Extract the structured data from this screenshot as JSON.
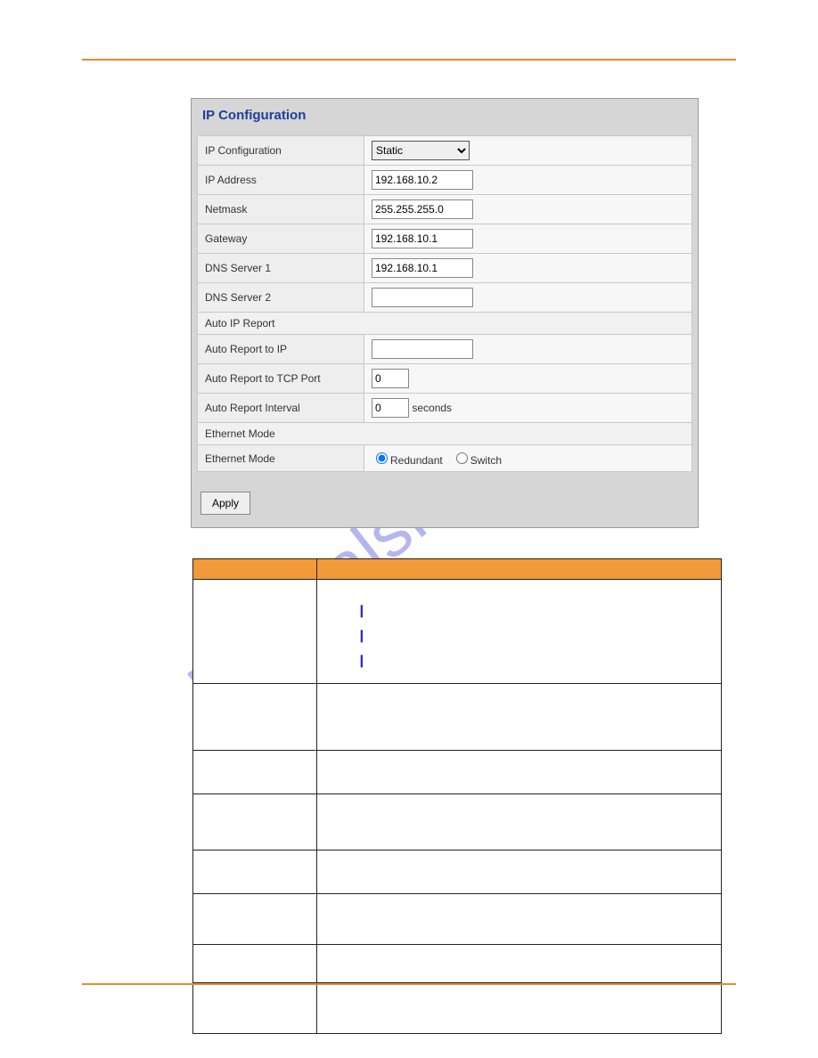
{
  "watermark": "manualshive.com",
  "panel": {
    "title": "IP Configuration",
    "rows": {
      "ip_configuration_label": "IP Configuration",
      "ip_configuration_value": "Static",
      "ip_address_label": "IP Address",
      "ip_address_value": "192.168.10.2",
      "netmask_label": "Netmask",
      "netmask_value": "255.255.255.0",
      "gateway_label": "Gateway",
      "gateway_value": "192.168.10.1",
      "dns1_label": "DNS Server 1",
      "dns1_value": "192.168.10.1",
      "dns2_label": "DNS Server 2",
      "dns2_value": "",
      "section_auto": "Auto IP Report",
      "auto_ip_label": "Auto Report to IP",
      "auto_ip_value": "",
      "auto_port_label": "Auto Report to TCP Port",
      "auto_port_value": "0",
      "auto_interval_label": "Auto Report Interval",
      "auto_interval_value": "0",
      "auto_interval_unit": "seconds",
      "section_eth": "Ethernet Mode",
      "eth_mode_label": "Ethernet Mode",
      "eth_opt_redundant": "Redundant",
      "eth_opt_switch": "Switch"
    },
    "apply": "Apply"
  }
}
